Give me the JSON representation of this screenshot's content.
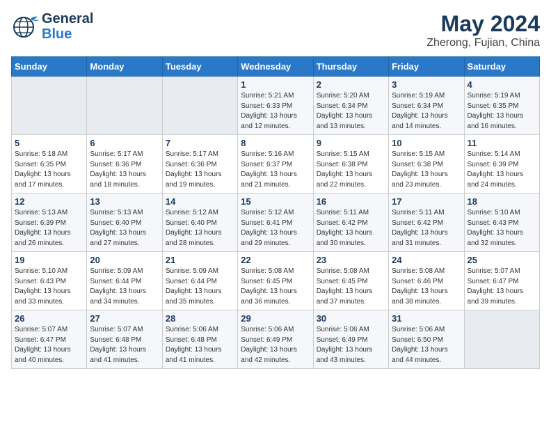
{
  "header": {
    "logo_general": "General",
    "logo_blue": "Blue",
    "month": "May 2024",
    "location": "Zherong, Fujian, China"
  },
  "weekdays": [
    "Sunday",
    "Monday",
    "Tuesday",
    "Wednesday",
    "Thursday",
    "Friday",
    "Saturday"
  ],
  "weeks": [
    [
      {
        "day": "",
        "info": ""
      },
      {
        "day": "",
        "info": ""
      },
      {
        "day": "",
        "info": ""
      },
      {
        "day": "1",
        "info": "Sunrise: 5:21 AM\nSunset: 6:33 PM\nDaylight: 13 hours\nand 12 minutes."
      },
      {
        "day": "2",
        "info": "Sunrise: 5:20 AM\nSunset: 6:34 PM\nDaylight: 13 hours\nand 13 minutes."
      },
      {
        "day": "3",
        "info": "Sunrise: 5:19 AM\nSunset: 6:34 PM\nDaylight: 13 hours\nand 14 minutes."
      },
      {
        "day": "4",
        "info": "Sunrise: 5:19 AM\nSunset: 6:35 PM\nDaylight: 13 hours\nand 16 minutes."
      }
    ],
    [
      {
        "day": "5",
        "info": "Sunrise: 5:18 AM\nSunset: 6:35 PM\nDaylight: 13 hours\nand 17 minutes."
      },
      {
        "day": "6",
        "info": "Sunrise: 5:17 AM\nSunset: 6:36 PM\nDaylight: 13 hours\nand 18 minutes."
      },
      {
        "day": "7",
        "info": "Sunrise: 5:17 AM\nSunset: 6:36 PM\nDaylight: 13 hours\nand 19 minutes."
      },
      {
        "day": "8",
        "info": "Sunrise: 5:16 AM\nSunset: 6:37 PM\nDaylight: 13 hours\nand 21 minutes."
      },
      {
        "day": "9",
        "info": "Sunrise: 5:15 AM\nSunset: 6:38 PM\nDaylight: 13 hours\nand 22 minutes."
      },
      {
        "day": "10",
        "info": "Sunrise: 5:15 AM\nSunset: 6:38 PM\nDaylight: 13 hours\nand 23 minutes."
      },
      {
        "day": "11",
        "info": "Sunrise: 5:14 AM\nSunset: 6:39 PM\nDaylight: 13 hours\nand 24 minutes."
      }
    ],
    [
      {
        "day": "12",
        "info": "Sunrise: 5:13 AM\nSunset: 6:39 PM\nDaylight: 13 hours\nand 26 minutes."
      },
      {
        "day": "13",
        "info": "Sunrise: 5:13 AM\nSunset: 6:40 PM\nDaylight: 13 hours\nand 27 minutes."
      },
      {
        "day": "14",
        "info": "Sunrise: 5:12 AM\nSunset: 6:40 PM\nDaylight: 13 hours\nand 28 minutes."
      },
      {
        "day": "15",
        "info": "Sunrise: 5:12 AM\nSunset: 6:41 PM\nDaylight: 13 hours\nand 29 minutes."
      },
      {
        "day": "16",
        "info": "Sunrise: 5:11 AM\nSunset: 6:42 PM\nDaylight: 13 hours\nand 30 minutes."
      },
      {
        "day": "17",
        "info": "Sunrise: 5:11 AM\nSunset: 6:42 PM\nDaylight: 13 hours\nand 31 minutes."
      },
      {
        "day": "18",
        "info": "Sunrise: 5:10 AM\nSunset: 6:43 PM\nDaylight: 13 hours\nand 32 minutes."
      }
    ],
    [
      {
        "day": "19",
        "info": "Sunrise: 5:10 AM\nSunset: 6:43 PM\nDaylight: 13 hours\nand 33 minutes."
      },
      {
        "day": "20",
        "info": "Sunrise: 5:09 AM\nSunset: 6:44 PM\nDaylight: 13 hours\nand 34 minutes."
      },
      {
        "day": "21",
        "info": "Sunrise: 5:09 AM\nSunset: 6:44 PM\nDaylight: 13 hours\nand 35 minutes."
      },
      {
        "day": "22",
        "info": "Sunrise: 5:08 AM\nSunset: 6:45 PM\nDaylight: 13 hours\nand 36 minutes."
      },
      {
        "day": "23",
        "info": "Sunrise: 5:08 AM\nSunset: 6:45 PM\nDaylight: 13 hours\nand 37 minutes."
      },
      {
        "day": "24",
        "info": "Sunrise: 5:08 AM\nSunset: 6:46 PM\nDaylight: 13 hours\nand 38 minutes."
      },
      {
        "day": "25",
        "info": "Sunrise: 5:07 AM\nSunset: 6:47 PM\nDaylight: 13 hours\nand 39 minutes."
      }
    ],
    [
      {
        "day": "26",
        "info": "Sunrise: 5:07 AM\nSunset: 6:47 PM\nDaylight: 13 hours\nand 40 minutes."
      },
      {
        "day": "27",
        "info": "Sunrise: 5:07 AM\nSunset: 6:48 PM\nDaylight: 13 hours\nand 41 minutes."
      },
      {
        "day": "28",
        "info": "Sunrise: 5:06 AM\nSunset: 6:48 PM\nDaylight: 13 hours\nand 41 minutes."
      },
      {
        "day": "29",
        "info": "Sunrise: 5:06 AM\nSunset: 6:49 PM\nDaylight: 13 hours\nand 42 minutes."
      },
      {
        "day": "30",
        "info": "Sunrise: 5:06 AM\nSunset: 6:49 PM\nDaylight: 13 hours\nand 43 minutes."
      },
      {
        "day": "31",
        "info": "Sunrise: 5:06 AM\nSunset: 6:50 PM\nDaylight: 13 hours\nand 44 minutes."
      },
      {
        "day": "",
        "info": ""
      }
    ]
  ]
}
